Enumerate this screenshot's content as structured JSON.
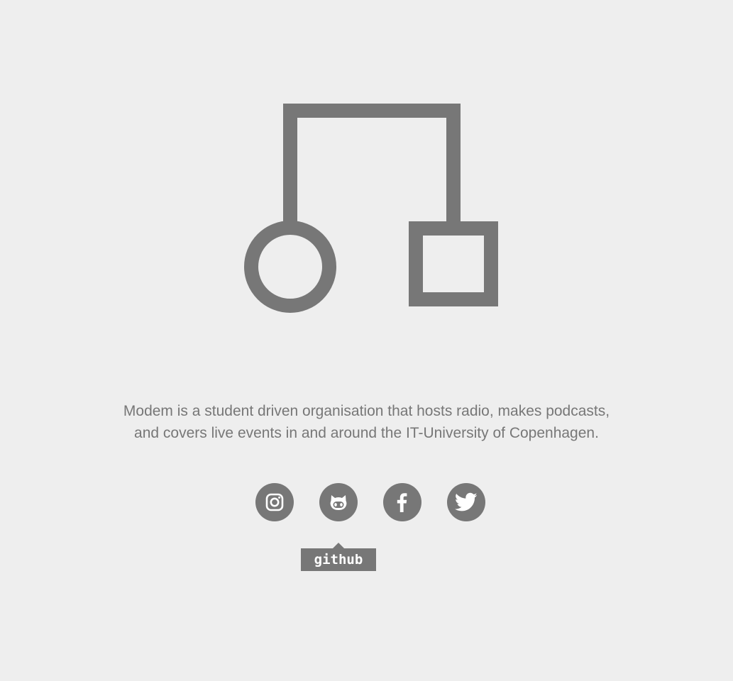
{
  "brand": {
    "logo_icon": "modem-logo-icon",
    "color": "#777777",
    "background": "#eeeeee"
  },
  "tagline": {
    "line1": "Modem is a student driven organisation that hosts radio, makes podcasts,",
    "line2": "and covers live events in and around the IT-University of Copenhagen."
  },
  "social": [
    {
      "name": "instagram",
      "icon": "instagram-icon"
    },
    {
      "name": "github",
      "icon": "github-icon"
    },
    {
      "name": "facebook",
      "icon": "facebook-icon"
    },
    {
      "name": "twitter",
      "icon": "twitter-icon"
    }
  ],
  "tooltip": {
    "text": "github"
  }
}
